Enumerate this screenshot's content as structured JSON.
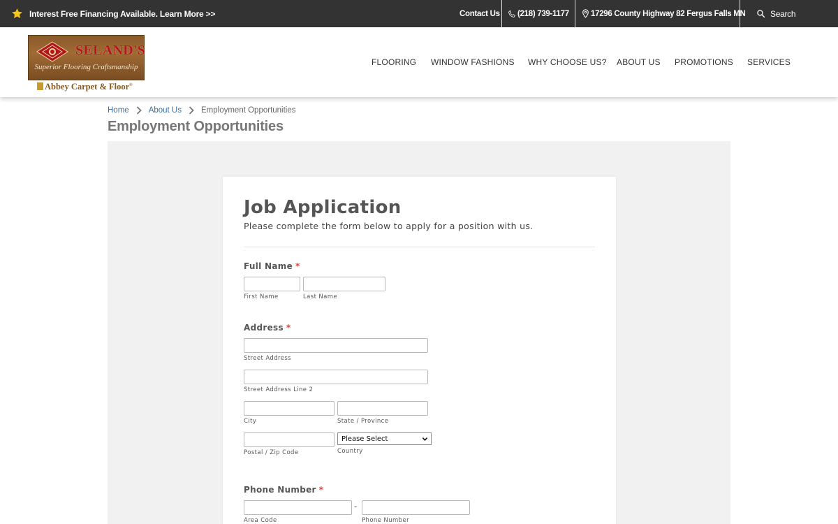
{
  "topbar": {
    "promo_text": "Interest Free Financing Available. Learn More >>",
    "contact_label": "Contact Us",
    "phone": "(218) 739-1177",
    "address": "17296 County Highway 82 Fergus Falls MN",
    "search_label": "Search",
    "star_color": "#f5c518"
  },
  "logo": {
    "brand": "SELAND'S",
    "tagline": "Superior Flooring Craftsmanship",
    "partner": "Abbey Carpet & Floor",
    "partner_mark": "®"
  },
  "nav": {
    "items": [
      "FLOORING",
      "WINDOW FASHIONS",
      "WHY CHOOSE US?",
      "ABOUT US",
      "PROMOTIONS",
      "SERVICES"
    ]
  },
  "breadcrumb": {
    "items": [
      "Home",
      "About Us",
      "Employment Opportunities"
    ]
  },
  "page": {
    "title": "Employment Opportunities"
  },
  "form": {
    "title": "Job Application",
    "subtitle": "Please complete the form below to apply for a position with us.",
    "required_mark": "*",
    "full_name": {
      "label": "Full Name",
      "first": "First Name",
      "last": "Last Name"
    },
    "address": {
      "label": "Address",
      "street": "Street Address",
      "street2": "Street Address Line 2",
      "city": "City",
      "state": "State / Province",
      "zip": "Postal / Zip Code",
      "country": "Country",
      "country_selected": "Please Select"
    },
    "phone": {
      "label": "Phone Number",
      "separator": "-",
      "area": "Area Code",
      "number": "Phone Number"
    }
  }
}
